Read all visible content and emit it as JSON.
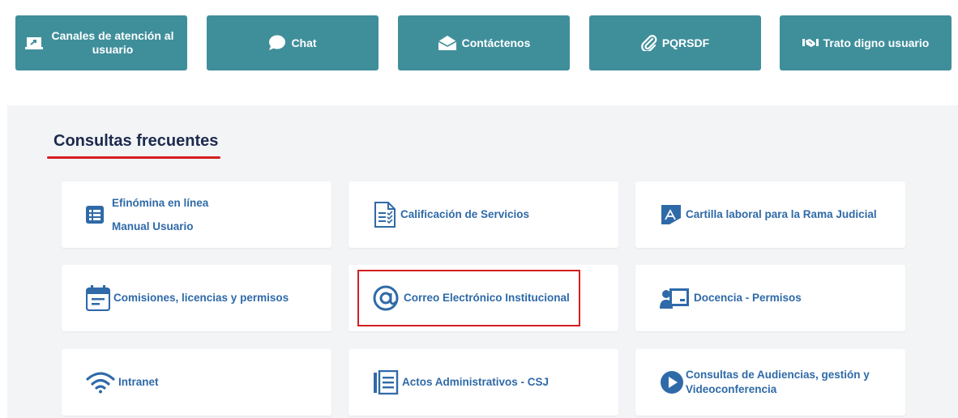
{
  "top_buttons": [
    {
      "label": "Canales de atención al usuario",
      "icon": "laptop-share-icon"
    },
    {
      "label": "Chat",
      "icon": "chat-bubble-icon"
    },
    {
      "label": "Contáctenos",
      "icon": "envelope-open-icon"
    },
    {
      "label": "PQRSDF",
      "icon": "paperclip-icon"
    },
    {
      "label": "Trato digno usuario",
      "icon": "handshake-icon"
    }
  ],
  "section": {
    "title": "Consultas frecuentes"
  },
  "cards": [
    {
      "line1": "Efinómina en línea",
      "line2": "Manual Usuario",
      "icon": "list-icon"
    },
    {
      "label": "Calificación de Servicios",
      "icon": "checklist-document-icon"
    },
    {
      "label": "Cartilla laboral para la Rama Judicial",
      "icon": "signature-icon"
    },
    {
      "label": "Comisiones, licencias y permisos",
      "icon": "calendar-icon"
    },
    {
      "label": "Correo Electrónico Institucional",
      "icon": "at-sign-icon"
    },
    {
      "label": "Docencia - Permisos",
      "icon": "teacher-board-icon"
    },
    {
      "label": "Intranet",
      "icon": "wifi-icon"
    },
    {
      "label": "Actos Administrativos - CSJ",
      "icon": "document-lines-icon"
    },
    {
      "line1": "Consultas de Audiencias, gestión y",
      "line2": "Videoconferencia",
      "icon": "play-circle-icon"
    }
  ],
  "colors": {
    "button_bg": "#3f8f9b",
    "link_blue": "#2f6aa8",
    "accent_red": "#d41f1f",
    "panel_bg": "#f3f4f6"
  }
}
